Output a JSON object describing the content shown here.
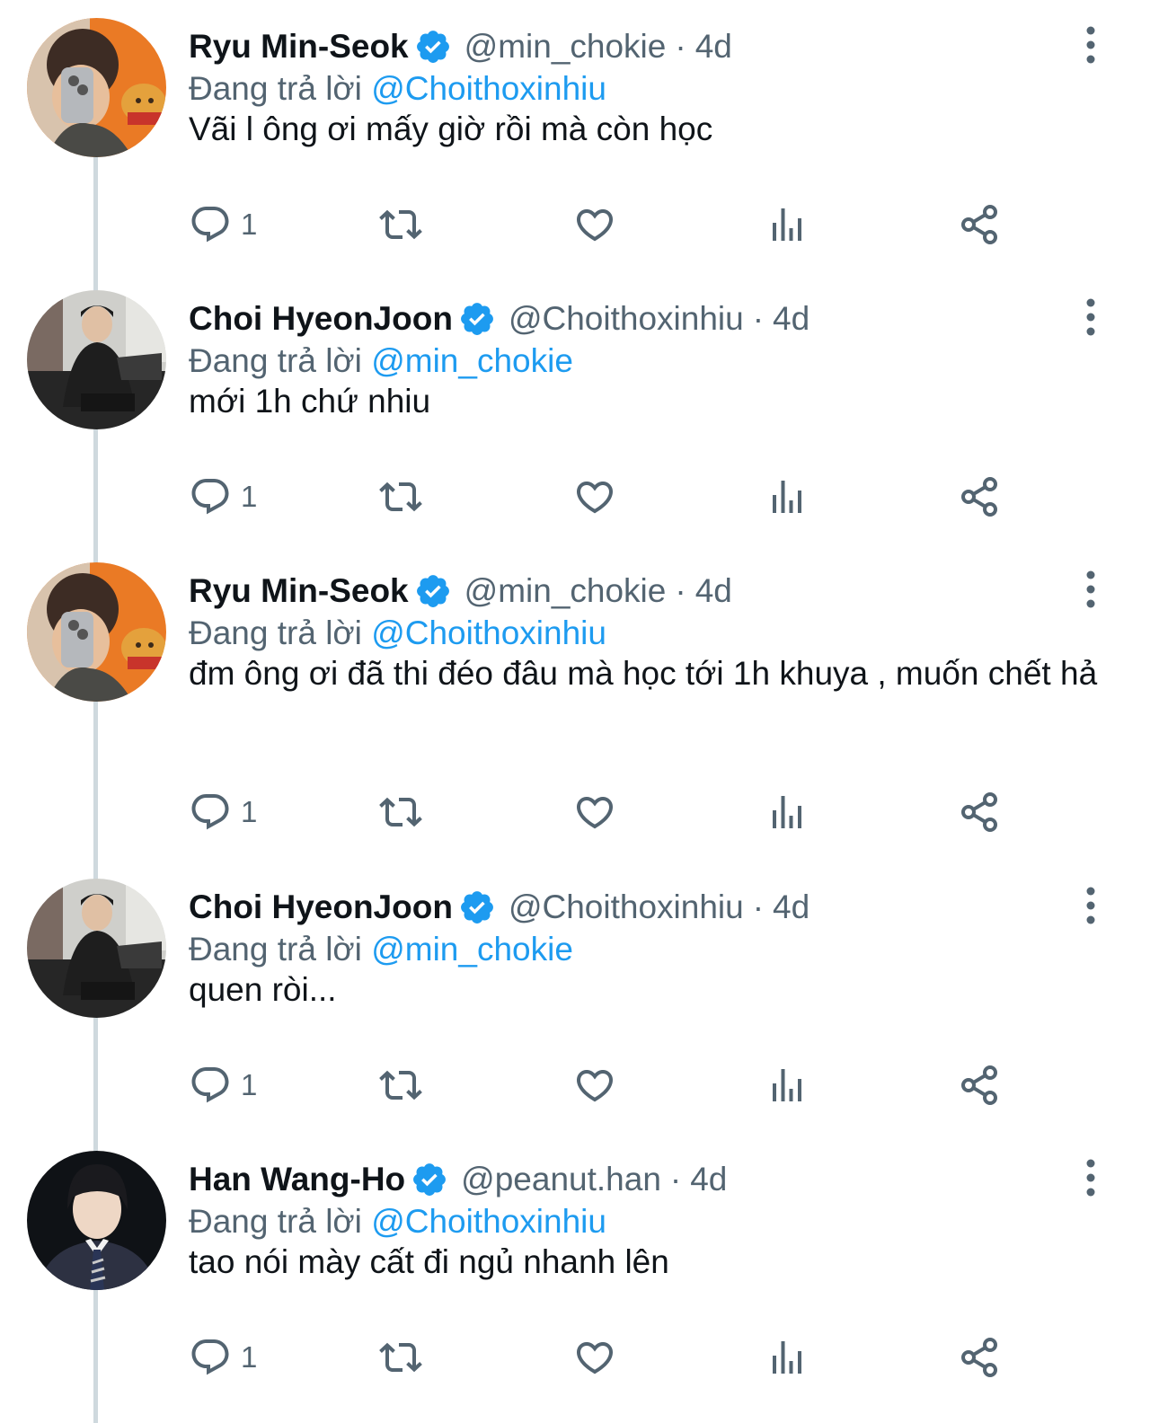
{
  "colors": {
    "accent": "#1d9bf0",
    "muted": "#536471",
    "text": "#0f1419",
    "thread_line": "#cfd9de"
  },
  "icons": {
    "verified": "verified-badge-icon",
    "more": "more-vertical-icon",
    "reply": "reply-icon",
    "retweet": "retweet-icon",
    "like": "heart-icon",
    "views": "views-icon",
    "share": "share-icon"
  },
  "tweets": [
    {
      "name": "Ryu Min-Seok",
      "handle": "@min_chokie",
      "separator": "·",
      "time": "4d",
      "reply_prefix": "Đang trả lời",
      "reply_to": "@Choithoxinhiu",
      "text": "Vãi l ông ơi mấy giờ rồi mà còn học",
      "reply_count": "1",
      "avatar": "orange-selfie"
    },
    {
      "name": "Choi HyeonJoon",
      "handle": "@Choithoxinhiu",
      "separator": "·",
      "time": "4d",
      "reply_prefix": "Đang trả lời",
      "reply_to": "@min_chokie",
      "text": "mới 1h chứ nhiu",
      "reply_count": "1",
      "avatar": "sitting-dark"
    },
    {
      "name": "Ryu Min-Seok",
      "handle": "@min_chokie",
      "separator": "·",
      "time": "4d",
      "reply_prefix": "Đang trả lời",
      "reply_to": "@Choithoxinhiu",
      "text": "đm ông ơi đã thi đéo đâu mà học tới 1h khuya , muốn chết hả",
      "reply_count": "1",
      "avatar": "orange-selfie"
    },
    {
      "name": "Choi HyeonJoon",
      "handle": "@Choithoxinhiu",
      "separator": "·",
      "time": "4d",
      "reply_prefix": "Đang trả lời",
      "reply_to": "@min_chokie",
      "text": "quen ròi...",
      "reply_count": "1",
      "avatar": "sitting-dark"
    },
    {
      "name": "Han Wang-Ho",
      "handle": "@peanut.han",
      "separator": "·",
      "time": "4d",
      "reply_prefix": "Đang trả lời",
      "reply_to": "@Choithoxinhiu",
      "text": "tao nói mày cất đi ngủ nhanh lên",
      "reply_count": "1",
      "avatar": "suit-portrait"
    }
  ]
}
